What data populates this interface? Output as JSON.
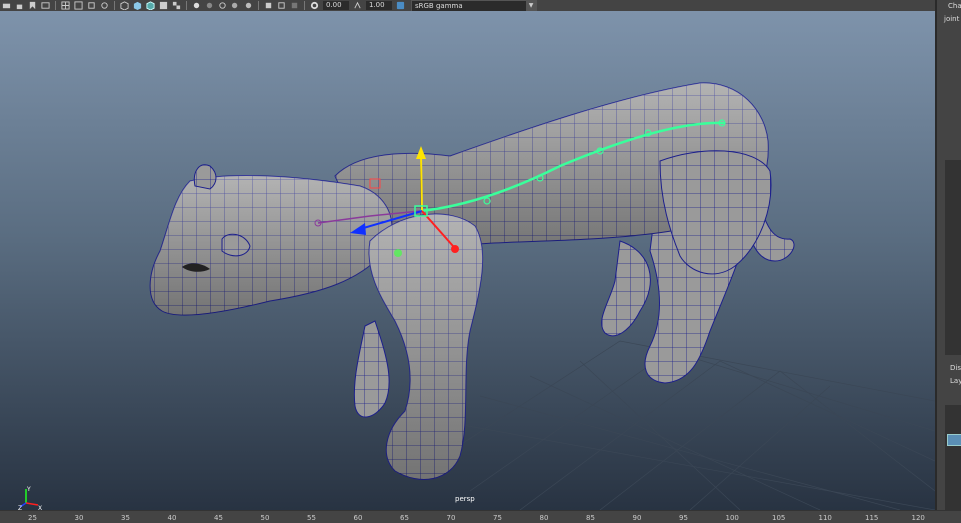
{
  "toolbar": {
    "value_a": "0.00",
    "value_b": "1.00",
    "color_space": "sRGB gamma"
  },
  "viewport": {
    "camera_label": "persp",
    "gizmo_labels": {
      "y": "Y",
      "z": "Z",
      "x": "X"
    }
  },
  "right_panel": {
    "label_1": "Cha",
    "label_2": "joint",
    "label_3": "Dis",
    "label_4": "Lay"
  },
  "timeline": {
    "ticks": [
      "25",
      "30",
      "35",
      "40",
      "45",
      "50",
      "55",
      "60",
      "65",
      "70",
      "75",
      "80",
      "85",
      "90",
      "95",
      "100",
      "105",
      "110",
      "115",
      "120"
    ]
  },
  "colors": {
    "viewport_top": "#7e93ab",
    "viewport_bottom": "#283342",
    "wireframe": "#1c1f8c",
    "spine": "#3aff9b"
  }
}
